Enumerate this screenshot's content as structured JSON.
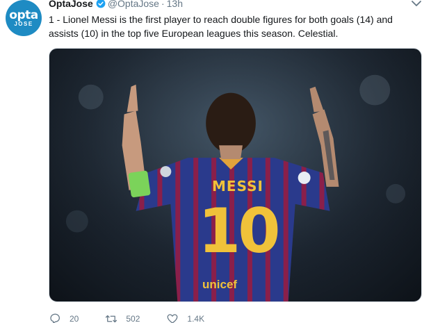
{
  "tweet": {
    "avatar_brand": "opta",
    "avatar_sub": "JOSE",
    "display_name": "OptaJose",
    "handle": "@OptaJose",
    "dot": "·",
    "time": "13h",
    "text": "1 - Lionel Messi is the first player to reach double figures for both goals (14) and assists (10) in the top five European leagues this season. Celestial."
  },
  "media": {
    "shirt_name": "MESSI",
    "shirt_number": "10",
    "sponsor": "unicef"
  },
  "actions": {
    "replies": "20",
    "retweets": "502",
    "likes": "1.4K"
  },
  "colors": {
    "accent": "#1da1f2",
    "avatar_bg": "#1e8bc3",
    "muted_text": "#657786"
  }
}
